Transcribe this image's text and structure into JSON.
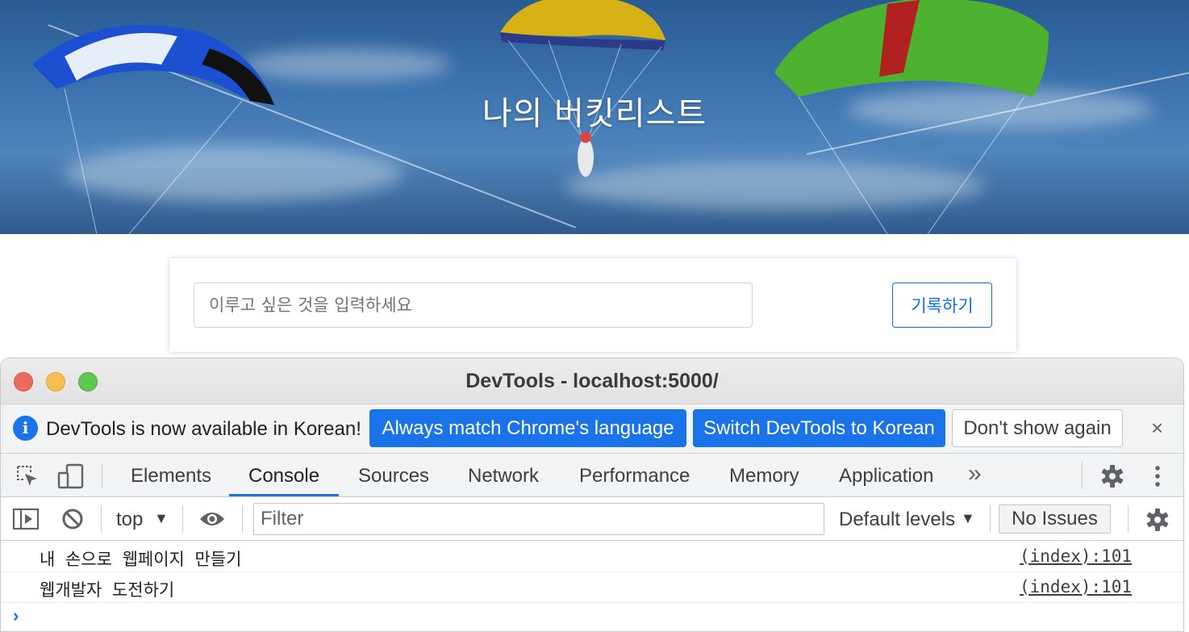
{
  "hero": {
    "title": "나의 버킷리스트"
  },
  "form": {
    "placeholder": "이루고 싶은 것을 입력하세요",
    "submit_label": "기록하기"
  },
  "devtools": {
    "window_title": "DevTools - localhost:5000/",
    "infobar": {
      "message": "DevTools is now available in Korean!",
      "btn_always_match": "Always match Chrome's language",
      "btn_switch": "Switch DevTools to Korean",
      "btn_dont_show": "Don't show again",
      "close": "×"
    },
    "tabs": [
      "Elements",
      "Console",
      "Sources",
      "Network",
      "Performance",
      "Memory",
      "Application"
    ],
    "active_tab": "Console",
    "more_tabs": "»",
    "filterbar": {
      "context": "top",
      "filter_placeholder": "Filter",
      "levels": "Default levels",
      "issues": "No Issues"
    },
    "console_rows": [
      {
        "message": "내 손으로 웹페이지 만들기",
        "source": "(index):101"
      },
      {
        "message": "웹개발자 도전하기",
        "source": "(index):101"
      }
    ],
    "prompt": "›"
  },
  "colors": {
    "accent": "#1a73e8",
    "bootstrap_primary": "#0d6efd",
    "close_red": "#ed6a5e",
    "minimize_yellow": "#f5bf4f",
    "zoom_green": "#61c554"
  }
}
